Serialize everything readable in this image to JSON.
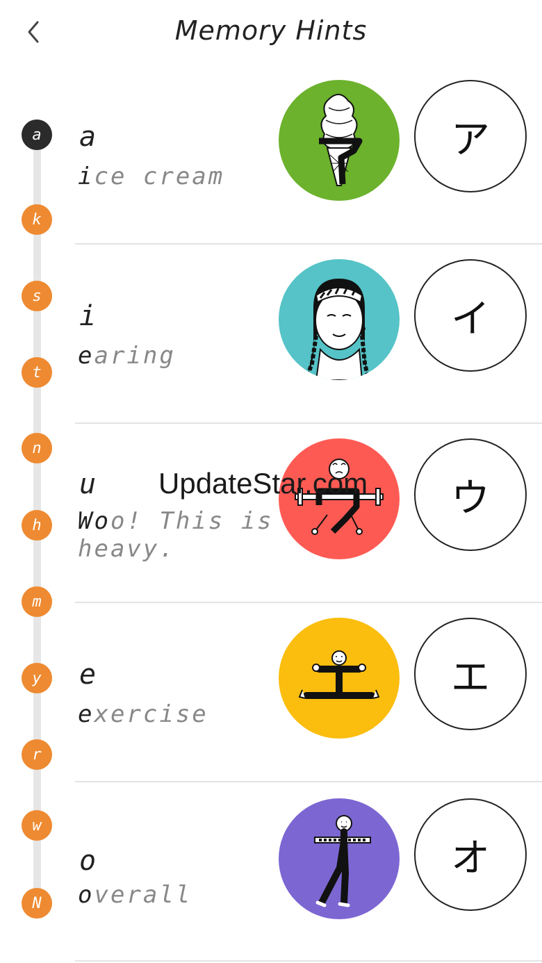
{
  "header": {
    "title": "Memory Hints",
    "back_icon": "chevron-left-icon"
  },
  "index": [
    "a",
    "k",
    "s",
    "t",
    "n",
    "h",
    "m",
    "y",
    "r",
    "w",
    "N"
  ],
  "index_active": "a",
  "colors": {
    "accent": "#ee8a31",
    "active": "#2b2b2b",
    "green": "#6cb22d",
    "teal": "#55c3c7",
    "red": "#fe5a54",
    "yellow": "#fbbd0e",
    "purple": "#7c66d2"
  },
  "rows": [
    {
      "romaji": "a",
      "hint_first": "i",
      "hint_rest": "ce cream",
      "kana": "ア",
      "picture": "ice-cream-cone"
    },
    {
      "romaji": "i",
      "hint_first": "e",
      "hint_rest": "aring",
      "kana": "イ",
      "picture": "girl-with-earring"
    },
    {
      "romaji": "u",
      "hint_first": "Wo",
      "hint_rest": "o! This is heavy.",
      "kana": "ウ",
      "picture": "weightlifter"
    },
    {
      "romaji": "e",
      "hint_first": "e",
      "hint_rest": "xercise",
      "kana": "エ",
      "picture": "person-doing-splits"
    },
    {
      "romaji": "o",
      "hint_first": "o",
      "hint_rest": "verall",
      "kana": "オ",
      "picture": "person-in-overalls"
    }
  ],
  "watermark": "UpdateStar.com"
}
